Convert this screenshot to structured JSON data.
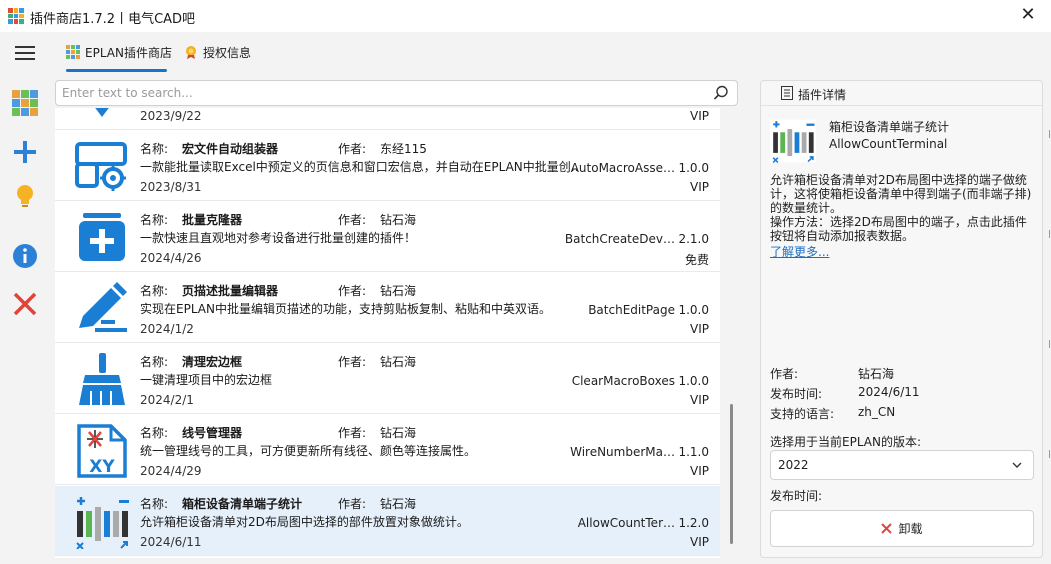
{
  "window": {
    "title": "插件商店1.7.2丨电气CAD吧"
  },
  "tabs": [
    {
      "label": "EPLAN插件商店",
      "active": true
    },
    {
      "label": "授权信息",
      "active": false
    }
  ],
  "search": {
    "placeholder": "Enter text to search..."
  },
  "labels": {
    "name": "名称:",
    "author": "作者:"
  },
  "plugins": [
    {
      "name": "",
      "author": "",
      "desc": "",
      "class": "",
      "version": "",
      "date": "2023/9/22",
      "license": "VIP"
    },
    {
      "name": "宏文件自动组装器",
      "author": "东经115",
      "desc": "一款能批量读取Excel中预定义的页信息和窗口宏信息，并自动在EPLAN中批量创…",
      "class": "AutoMacroAsse…",
      "version": "1.0.0",
      "date": "2023/8/31",
      "license": "VIP"
    },
    {
      "name": "批量克隆器",
      "author": "钻石海",
      "desc": "一款快速且直观地对参考设备进行批量创建的插件！",
      "class": "BatchCreateDev…",
      "version": "2.1.0",
      "date": "2024/4/26",
      "license": "免费"
    },
    {
      "name": "页描述批量编辑器",
      "author": "钻石海",
      "desc": "实现在EPLAN中批量编辑页描述的功能，支持剪贴板复制、粘贴和中英双语。",
      "class": "BatchEditPage",
      "version": "1.0.0",
      "date": "2024/1/2",
      "license": "VIP"
    },
    {
      "name": "清理宏边框",
      "author": "钻石海",
      "desc": "一键清理项目中的宏边框",
      "class": "ClearMacroBoxes",
      "version": "1.0.0",
      "date": "2024/2/1",
      "license": "VIP"
    },
    {
      "name": "线号管理器",
      "author": "钻石海",
      "desc": "统一管理线号的工具，可方便更新所有线径、颜色等连接属性。",
      "class": "WireNumberMa…",
      "version": "1.1.0",
      "date": "2024/4/29",
      "license": "VIP"
    },
    {
      "name": "箱柜设备清单端子统计",
      "author": "钻石海",
      "desc": "允许箱柜设备清单对2D布局图中选择的部件放置对象做统计。",
      "class": "AllowCountTer…",
      "version": "1.2.0",
      "date": "2024/6/11",
      "license": "VIP"
    }
  ],
  "detail": {
    "header": "插件详情",
    "name": "箱柜设备清单端子统计",
    "class": "AllowCountTerminal",
    "description": "允许箱柜设备清单对2D布局图中选择的端子做统计，这将使箱柜设备清单中得到端子(而非端子排)的数量统计。\n操作方法：选择2D布局图中的端子，点击此插件按钮将自动添加报表数据。",
    "learn_more": "了解更多...",
    "author_label": "作者:",
    "author": "钻石海",
    "release_label": "发布时间:",
    "release": "2024/6/11",
    "lang_label": "支持的语言:",
    "lang": "zh_CN",
    "version_label": "选择用于当前EPLAN的版本:",
    "version_selected": "2022",
    "publish_label": "发布时间:",
    "uninstall_label": "卸载"
  },
  "colors": {
    "accent": "#1a73c7",
    "icon_blue": "#1a7fd4",
    "danger": "#d8443a",
    "selected_row": "#e5f0fb"
  }
}
